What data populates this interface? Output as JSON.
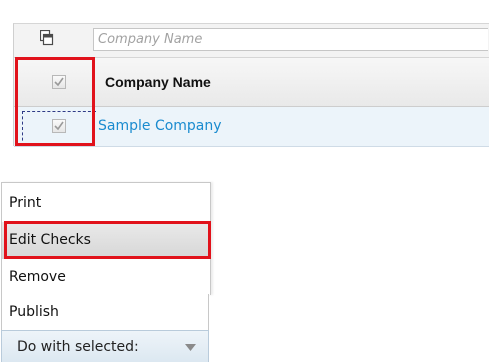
{
  "grid": {
    "filter": {
      "placeholder": "Company Name",
      "value": ""
    },
    "header": {
      "company_name_label": "Company Name"
    },
    "rows": [
      {
        "company_name": "Sample Company"
      }
    ]
  },
  "menu": {
    "items": [
      {
        "label": "Print"
      },
      {
        "label": "Edit Checks"
      },
      {
        "label": "Remove"
      },
      {
        "label": "Publish"
      }
    ],
    "button_label": "Do with selected:"
  },
  "colors": {
    "highlight": "#e1121b",
    "link": "#1a8bcf"
  },
  "icons": [
    "copy-columns-icon",
    "checkbox-icon",
    "chevron-down-icon"
  ]
}
